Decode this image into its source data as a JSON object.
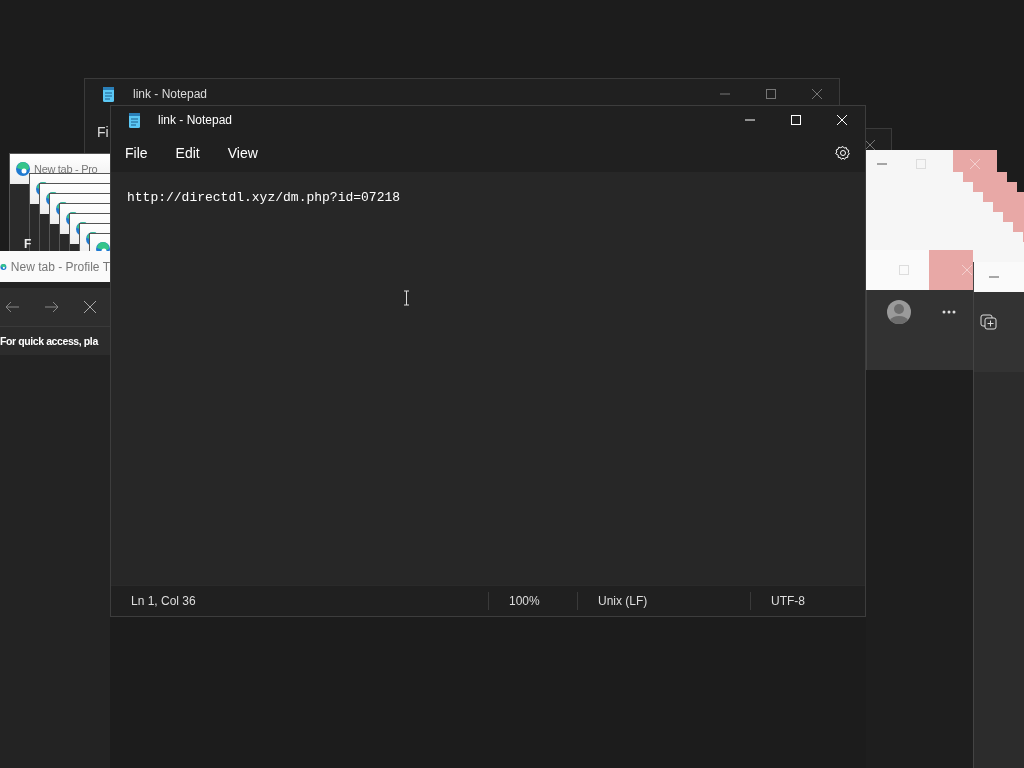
{
  "back_notepad": {
    "title": "link - Notepad",
    "menu_fragment": "Fi"
  },
  "browser_windows": [
    {
      "title": "New tab - Pro",
      "body_fragment": "F"
    },
    {
      "title": "New tab - Profile T",
      "hint": "For quick access, pla"
    }
  ],
  "notepad": {
    "title": "link - Notepad",
    "menus": [
      "File",
      "Edit",
      "View"
    ],
    "content": "http://directdl.xyz/dm.php?id=07218",
    "status": [
      "Ln 1, Col 36",
      "100%",
      "Unix (LF)",
      "UTF-8"
    ]
  }
}
